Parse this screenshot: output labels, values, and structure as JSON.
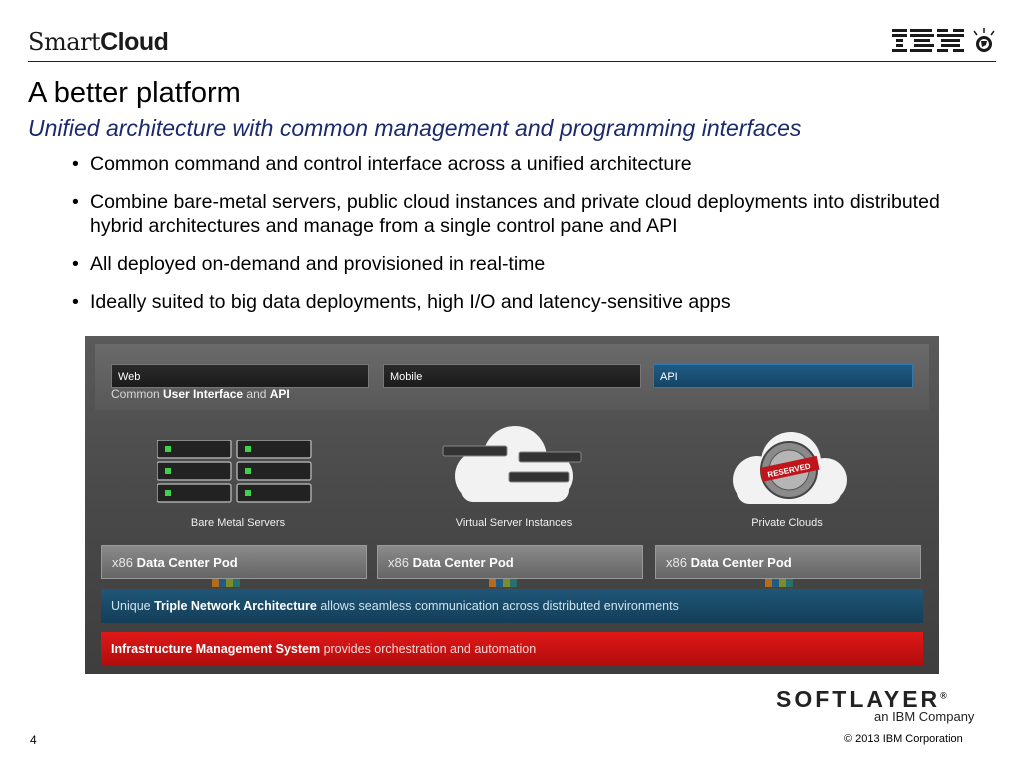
{
  "header": {
    "brand_part1": "Smart",
    "brand_part2": "Cloud",
    "ibm_logo": "IBM"
  },
  "slide": {
    "title": "A better platform",
    "subtitle": "Unified architecture with common management and programming interfaces",
    "bullets": [
      "Common command and control interface across a unified architecture",
      "Combine bare-metal servers, public cloud instances and private cloud deployments into distributed hybrid architectures and manage from a single control pane and API",
      "All deployed on-demand and provisioned in real-time",
      "Ideally suited to big data deployments, high I/O and latency-sensitive apps"
    ]
  },
  "diagram": {
    "tabs": [
      "Web",
      "Mobile",
      "API"
    ],
    "caption_a": "Common ",
    "caption_b": "User Interface",
    "caption_c": " and ",
    "caption_d": "API",
    "services": [
      "Bare Metal Servers",
      "Virtual Server Instances",
      "Private Clouds"
    ],
    "private_cloud_stamp": "RESERVED",
    "pod_prefix": "x86 ",
    "pod_label": "Data Center Pod",
    "network_a": "Unique ",
    "network_b": "Triple Network Architecture",
    "network_c": " allows seamless communication across distributed environments",
    "ims_a": "Infrastructure Management System",
    "ims_b": " provides orchestration and automation"
  },
  "footer": {
    "logo": "SOFTLAYER",
    "logo_mark": "®",
    "logo_sub": "an IBM Company",
    "page_number": "4",
    "copyright": "© 2013 IBM Corporation"
  },
  "colors": {
    "subtitle": "#1a2a6c",
    "api_tab": "#1f5b84",
    "network_bar": "#1f5677",
    "ims_bar": "#d01212"
  }
}
